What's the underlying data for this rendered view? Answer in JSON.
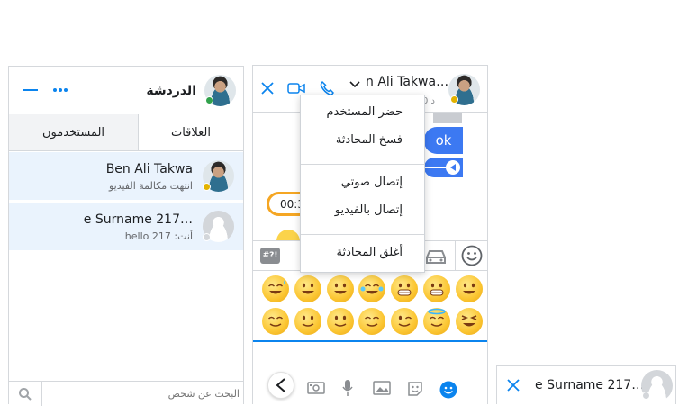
{
  "colors": {
    "accent": "#0b84ee",
    "bubble_blue": "#3c79f2",
    "online": "#31a24c",
    "away": "#e3b300",
    "selected_row": "#eaf3fd",
    "orange": "#f5a623"
  },
  "list_panel": {
    "title": "الدردشة",
    "more_icon": "more-icon",
    "minimize_icon": "minimize-icon",
    "tabs": [
      {
        "label": "العلاقات",
        "active": true
      },
      {
        "label": "المستخدمون",
        "active": false
      }
    ],
    "conversations": [
      {
        "name": "Ben Ali Takwa",
        "preview": "انتهت مكالمة الفيديو",
        "status": "away"
      },
      {
        "name": "e Surname 217…",
        "preview": "hello 217 :أنت",
        "status": "offline"
      }
    ],
    "search": {
      "placeholder": "البحث عن شخص"
    }
  },
  "chat_window": {
    "name": "n Ali Takwa…",
    "status_hint": "0 د",
    "message_in": "ok",
    "call_duration": "00:3",
    "icons": [
      "close-icon",
      "video-icon",
      "phone-icon",
      "chevron-down-icon"
    ],
    "emoji_categories": [
      "#?!",
      "car",
      "smiley"
    ],
    "emojis_row1": [
      "sweat-smile",
      "grin",
      "big-smile",
      "laugh-tears",
      "grimace",
      "grimace-teeth",
      "smile-open"
    ],
    "emojis_row2": [
      "relieved",
      "upside-down",
      "slight-smile",
      "blush",
      "wink",
      "halo",
      "laughing"
    ],
    "toolbar_icons": [
      "back-arrow",
      "camera",
      "microphone",
      "image",
      "sticker",
      "emoji"
    ]
  },
  "menu": {
    "items": [
      "حضر المستخدم",
      "فسخ المحادثة",
      "إتصال صوتي",
      "إتصال بالفيديو",
      "أغلق المحادثة"
    ]
  },
  "mini_bar": {
    "name": "e Surname 217…"
  }
}
